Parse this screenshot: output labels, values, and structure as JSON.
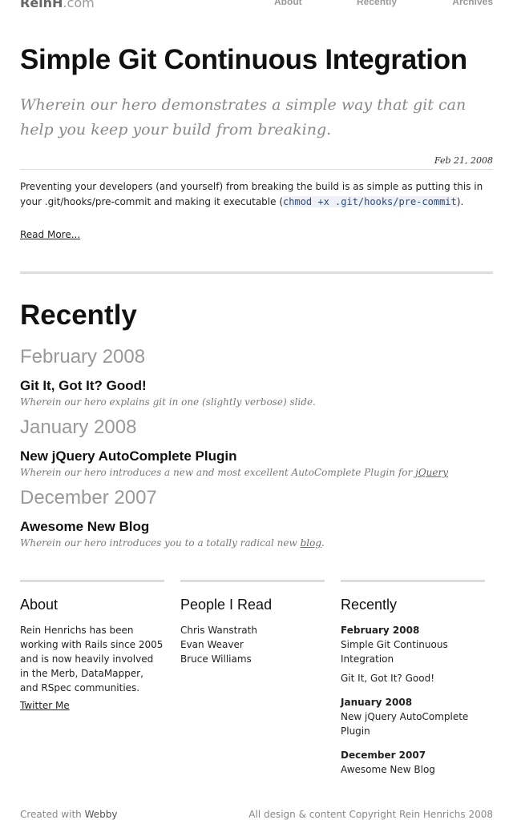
{
  "header": {
    "logo_main": "ReinH",
    "logo_suffix": ".com",
    "nav": [
      "About",
      "Recently",
      "Archives"
    ]
  },
  "post": {
    "title": "Simple Git Continuous Integration",
    "subtitle": "Wherein our hero demonstrates a simple way that git can help you keep your build from breaking.",
    "date": "Feb 21, 2008",
    "body_before": "Preventing your developers (and yourself) from breaking the build is as simple as putting this in your .git/hooks/pre-commit and making it executable (",
    "body_code": "chmod +x .git/hooks/pre-commit",
    "body_after": ").",
    "read_more": "Read More..."
  },
  "recently": {
    "heading": "Recently",
    "groups": [
      {
        "month": "February 2008",
        "title": "Git It, Got It? Good!",
        "desc": "Wherein our hero explains git in one (slightly verbose) slide.",
        "desc_link": "",
        "desc_end": ""
      },
      {
        "month": "January 2008",
        "title": "New jQuery AutoComplete Plugin",
        "desc": "Wherein our hero introduces a new and most excellent AutoComplete Plugin for ",
        "desc_link": "jQuery",
        "desc_end": ""
      },
      {
        "month": "December 2007",
        "title": "Awesome New Blog",
        "desc": "Wherein our hero introduces you to a totally radical new ",
        "desc_link": "blog",
        "desc_end": "."
      }
    ]
  },
  "footer_cols": {
    "about": {
      "heading": "About",
      "text": "Rein Henrichs has been working with Rails since 2005 and is now heavily involved in the Merb, DataMapper, and RSpec communities.",
      "link": "Twitter Me"
    },
    "people": {
      "heading": "People I Read",
      "names": [
        "Chris Wanstrath",
        "Evan Weaver",
        "Bruce Williams"
      ]
    },
    "recent": {
      "heading": "Recently",
      "groups": [
        {
          "month": "February 2008",
          "entries": [
            "Simple Git Continuous Integration",
            "Git It, Got It? Good!"
          ]
        },
        {
          "month": "January 2008",
          "entries": [
            "New jQuery AutoComplete Plugin"
          ]
        },
        {
          "month": "December 2007",
          "entries": [
            "Awesome New Blog"
          ]
        }
      ]
    }
  },
  "footer": {
    "created_prefix": "Created with ",
    "created_link": "Webby",
    "copyright": "All design & content Copyright Rein Henrichs 2008"
  }
}
